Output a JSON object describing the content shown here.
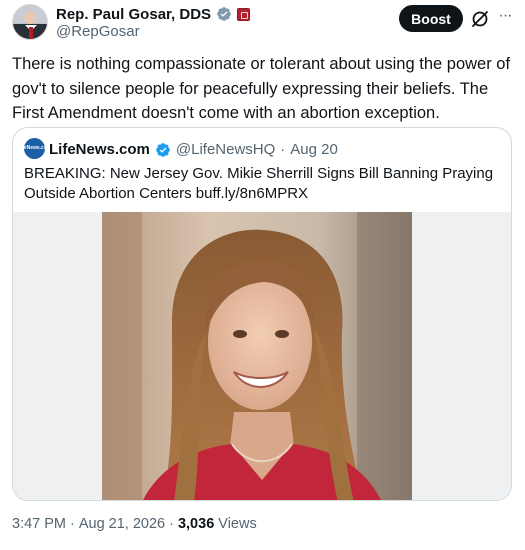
{
  "author": {
    "display_name": "Rep. Paul Gosar, DDS",
    "handle": "@RepGosar"
  },
  "actions": {
    "boost_label": "Boost"
  },
  "icons": {
    "verified": "verified-badge-icon",
    "affiliation": "house-seal-icon",
    "grok": "grok-icon",
    "more": "more-options-icon"
  },
  "tweet": {
    "text": "There is nothing compassionate or tolerant about using the power of gov't to silence people for peacefully expressing their beliefs.  The First Amendment doesn't come with an abortion exception."
  },
  "quote": {
    "logo_text": "LifeNews.com",
    "name": "LifeNews.com",
    "handle": "@LifeNewsHQ",
    "separator": "·",
    "date": "Aug 20",
    "text": "BREAKING: New Jersey Gov. Mikie Sherrill Signs Bill Banning Praying Outside Abortion Centers buff.ly/8n6MPRX"
  },
  "meta": {
    "time": "3:47 PM",
    "dot1": "·",
    "date": "Aug 21, 2026",
    "dot2": "·",
    "views_count": "3,036",
    "views_label": "Views"
  },
  "colors": {
    "text": "#0f1419",
    "secondary": "#536471",
    "verified": "#1d9bf0",
    "border": "#cfd9de",
    "boost_bg": "#0f1419"
  }
}
